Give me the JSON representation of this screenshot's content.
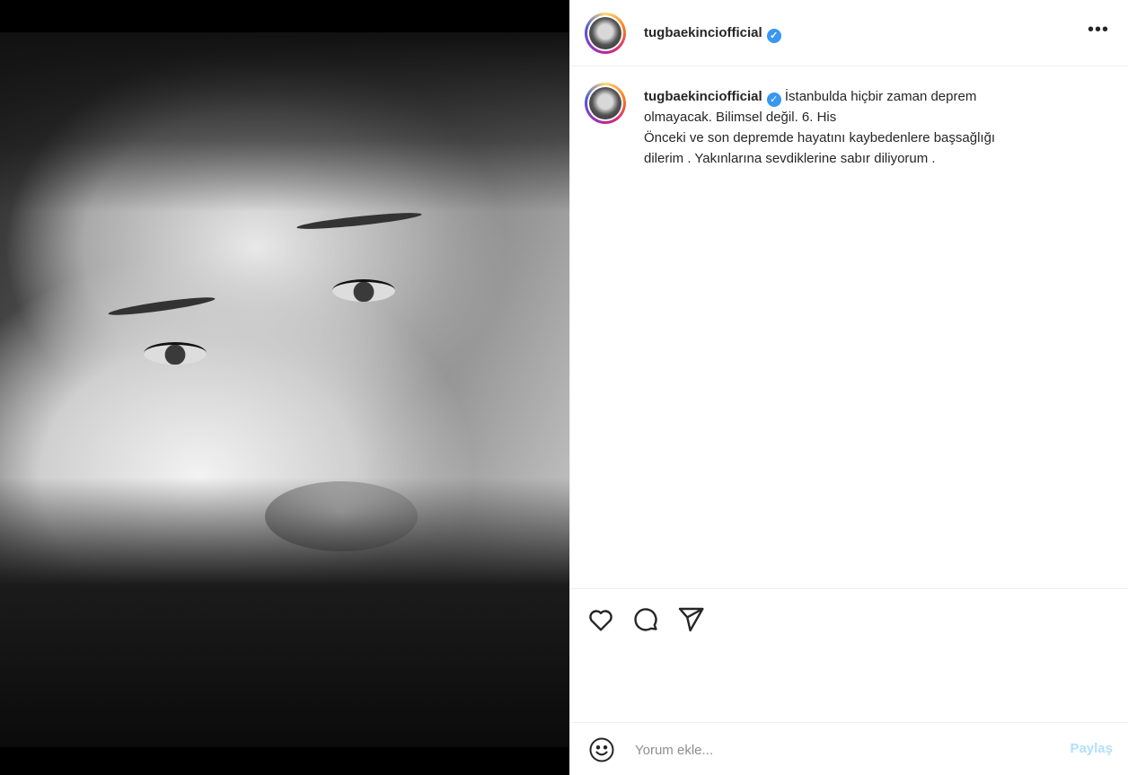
{
  "post": {
    "username": "tugbaekinciofficial",
    "verified_icon": "verified-badge-icon",
    "more_label": "•••",
    "caption_lines": [
      "İstanbulda hiçbir zaman deprem",
      "olmayacak. Bilimsel değil. 6. His",
      "Önceki ve son depremde hayatını kaybedenlere başsağlığı",
      "dilerim . Yakınlarına sevdiklerine sabır diliyorum ."
    ]
  },
  "actions": {
    "icons": [
      "heart-icon",
      "comment-icon",
      "share-icon"
    ]
  },
  "composer": {
    "placeholder": "Yorum ekle...",
    "share_label": "Paylaş",
    "emoji_icon": "emoji-icon"
  },
  "colors": {
    "text": "#262626",
    "verified": "#3897f0",
    "share_disabled": "#b2dffc",
    "divider": "#efefef"
  }
}
